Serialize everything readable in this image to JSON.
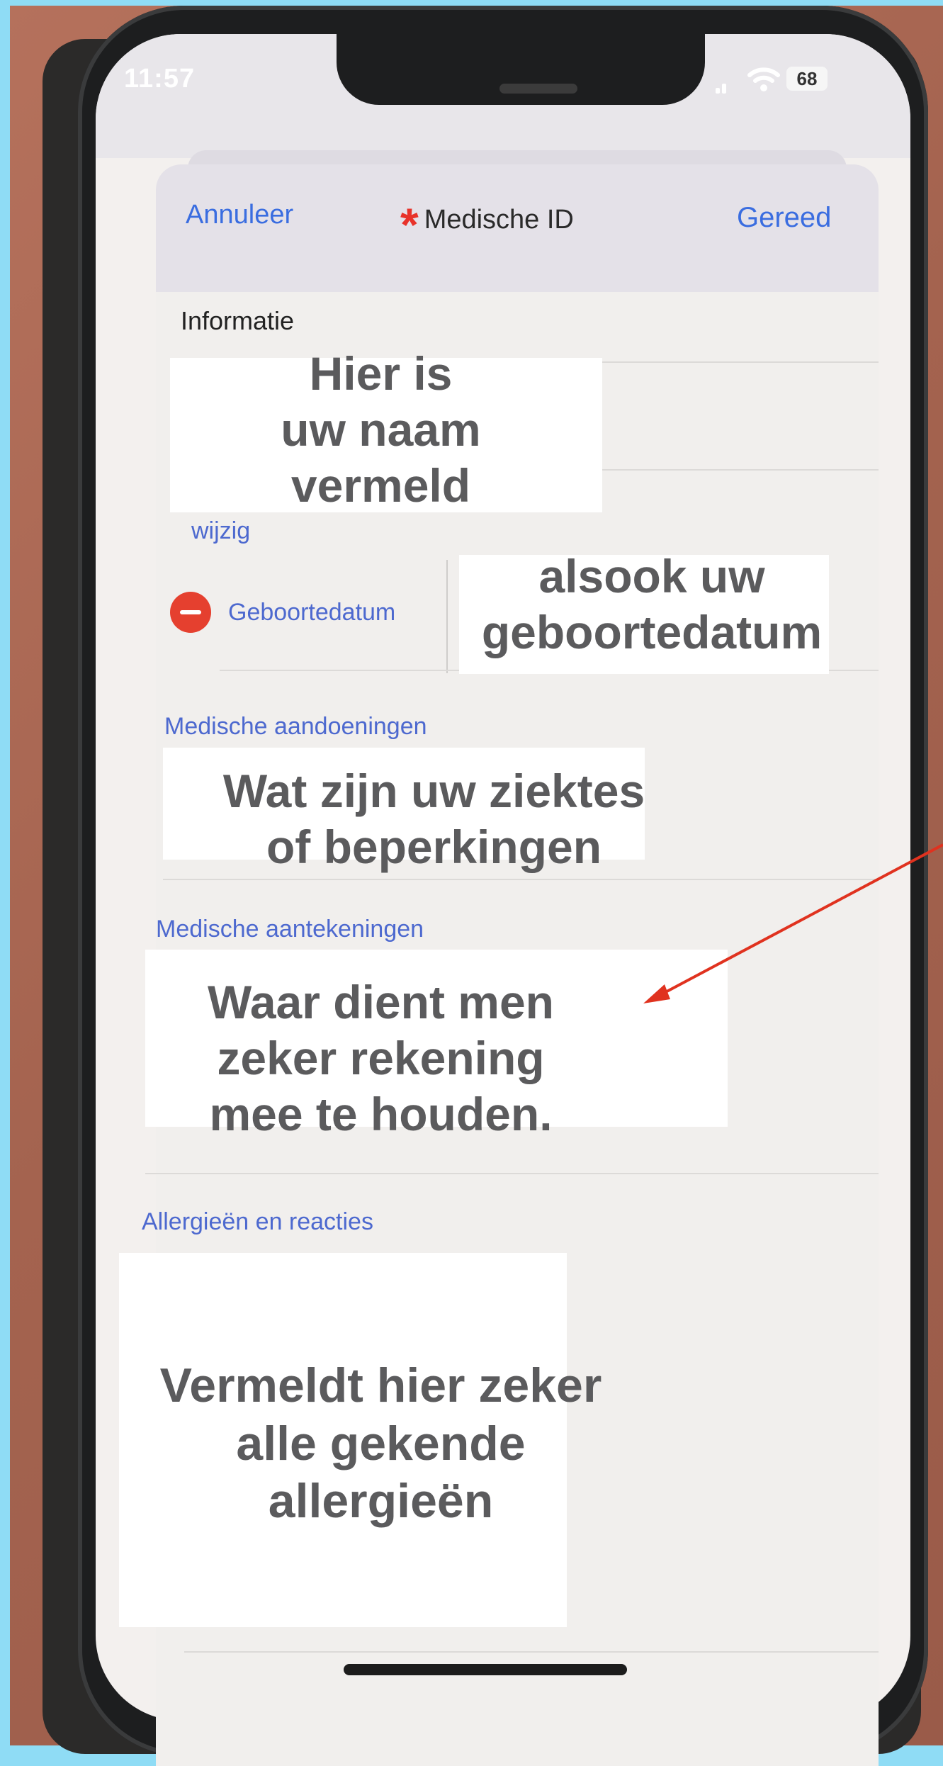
{
  "status_bar": {
    "time": "11:57",
    "battery": "68"
  },
  "nav": {
    "cancel_label": "Annuleer",
    "title": "Medische ID",
    "done_label": "Gereed"
  },
  "informatie": {
    "header": "Informatie",
    "edit_label": "wijzig",
    "birthdate_label": "Geboortedatum"
  },
  "sections": {
    "conditions": "Medische aandoeningen",
    "notes": "Medische aantekeningen",
    "allergies": "Allergieën en reacties"
  },
  "annotations": {
    "name": "Hier is\nuw naam\nvermeld",
    "birthdate": "alsook uw\ngeboortedatum",
    "conditions": "Wat zijn uw ziektes\nof beperkingen",
    "notes": "Waar dient men\nzeker rekening\nmee te houden.",
    "allergies": "Vermeldt hier zeker\nalle gekende\nallergieën"
  },
  "colors": {
    "accent": "#3a6de0",
    "remove": "#e5402f",
    "medical_asterisk": "#e8322a",
    "arrow": "#e0321f"
  },
  "icons": [
    "asterisk-icon",
    "signal-icon",
    "wifi-icon",
    "battery-icon",
    "remove-icon"
  ]
}
